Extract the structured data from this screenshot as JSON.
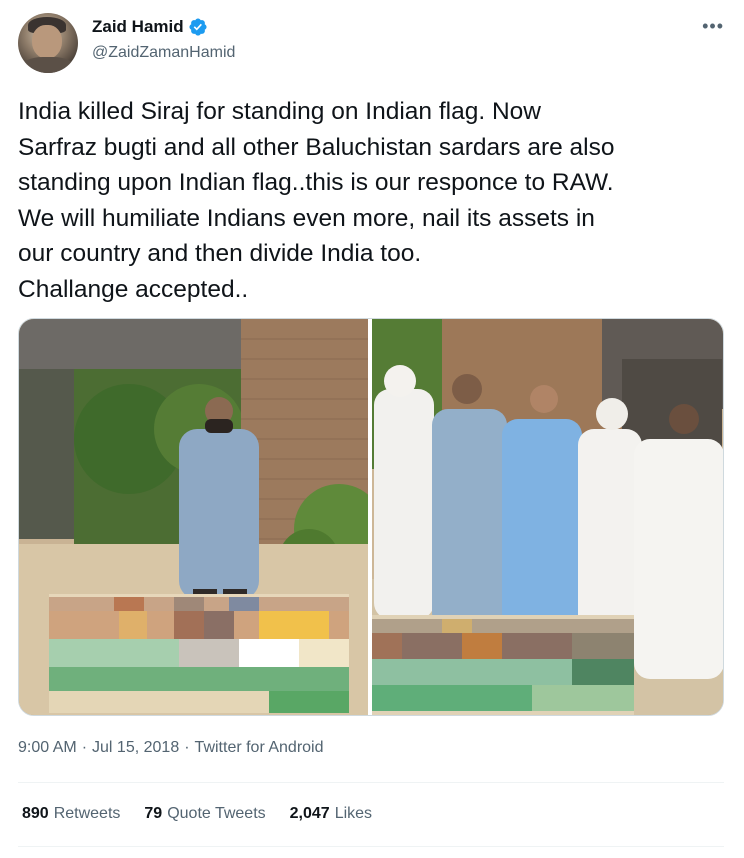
{
  "author": {
    "display_name": "Zaid Hamid",
    "handle": "@ZaidZamanHamid",
    "verified": true,
    "avatar_icon": "profile-photo"
  },
  "more_icon": "ellipsis-icon",
  "tweet": {
    "text": "India killed Siraj for standing on Indian flag. Now\nSarfraz bugti and all other Baluchistan sardars are also\nstanding upon Indian flag..this is our responce to RAW.\nWe will humiliate Indians even more, nail its assets in\nour country and then divide India too.\nChallange accepted.."
  },
  "media": {
    "count": 2,
    "blur_note": "pixelated region"
  },
  "meta": {
    "time": "9:00 AM",
    "sep1": "·",
    "date": "Jul 15, 2018",
    "sep2": "·",
    "source": "Twitter for Android"
  },
  "stats": {
    "retweets_count": "890",
    "retweets_label": "Retweets",
    "quotes_count": "79",
    "quotes_label": "Quote Tweets",
    "likes_count": "2,047",
    "likes_label": "Likes"
  },
  "colors": {
    "text_primary": "#0f1419",
    "text_secondary": "#536471",
    "verified_blue": "#1d9bf0",
    "divider": "#eff3f4"
  }
}
